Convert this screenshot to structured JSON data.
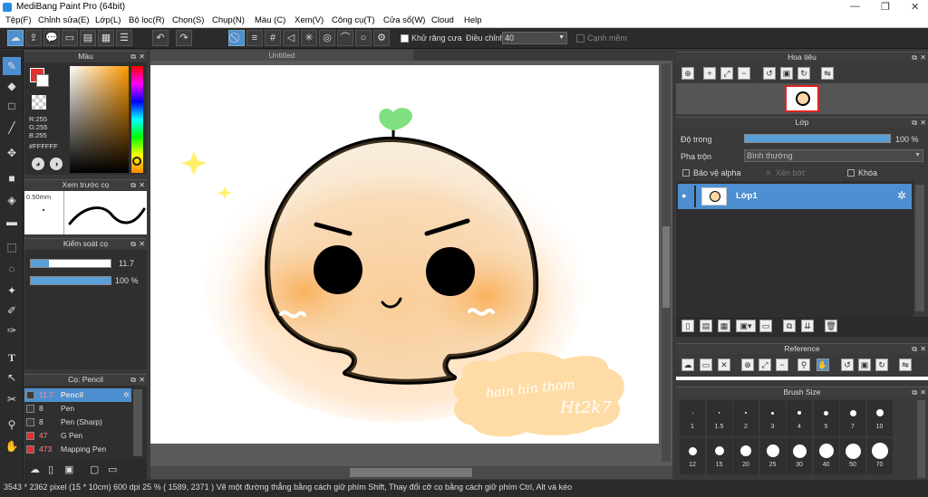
{
  "app": {
    "title": "MediBang Paint Pro (64bit)"
  },
  "menu": [
    "Tệp(F)",
    "Chỉnh sửa(E)",
    "Lớp(L)",
    "Bộ lọc(R)",
    "Chọn(S)",
    "Chụp(N)",
    "Màu (C)",
    "Xem(V)",
    "Công cụ(T)",
    "Cửa sổ(W)",
    "Cloud",
    "Help"
  ],
  "toolbar": {
    "antialias_label": "Khử răng cưa",
    "adjust_label": "Điều chỉnh",
    "adjust_value": "40",
    "snap_label": "Cạnh mềm"
  },
  "color_panel": {
    "title": "Màu",
    "r": "R:255",
    "g": "G:255",
    "b": "B:255",
    "hex": "#FFFFFF"
  },
  "brush_preview": {
    "title": "Xem trước cọ",
    "size": "0.50mm"
  },
  "brush_control": {
    "title": "Kiểm soát cọ",
    "size_value": "11.7",
    "opacity_value": "100 %"
  },
  "brush_list": {
    "title": "Cọ: Pencil",
    "items": [
      {
        "size": "11.7",
        "name": "Pencil",
        "color": "#3a3a3a"
      },
      {
        "size": "8",
        "name": "Pen",
        "color": "#3a3a3a"
      },
      {
        "size": "8",
        "name": "Pen (Sharp)",
        "color": "#3a3a3a"
      },
      {
        "size": "47",
        "name": "G Pen",
        "color": "#e03030"
      },
      {
        "size": "473",
        "name": "Mapping Pen",
        "color": "#e03030"
      }
    ]
  },
  "document": {
    "tab": "Untitled"
  },
  "artwork": {
    "line1": "hain hin thom",
    "line2": "Ht2k7"
  },
  "navigator": {
    "title": "Hoa tiêu"
  },
  "layers": {
    "title": "Lớp",
    "opacity_label": "Độ trong",
    "opacity_value": "100 %",
    "blend_label": "Pha trộn",
    "blend_value": "Bình thường",
    "protect_alpha": "Bảo vệ alpha",
    "clip": "Xén bớt",
    "lock": "Khóa",
    "layer_name": "Lớp1"
  },
  "reference": {
    "title": "Reference"
  },
  "brush_size": {
    "title": "Brush Size",
    "sizes": [
      "1",
      "1.5",
      "2",
      "3",
      "4",
      "5",
      "7",
      "10",
      "12",
      "15",
      "20",
      "25",
      "30",
      "40",
      "50",
      "70"
    ]
  },
  "status": {
    "text": "3543 * 2362 pixel  (15 * 10cm)  600 dpi  25 %  ( 1589, 2371 )  Vẽ một đường thẳng bằng cách giữ phím Shift, Thay đổi cỡ cọ bằng cách giữ phím Ctrl, Alt và kéo"
  }
}
